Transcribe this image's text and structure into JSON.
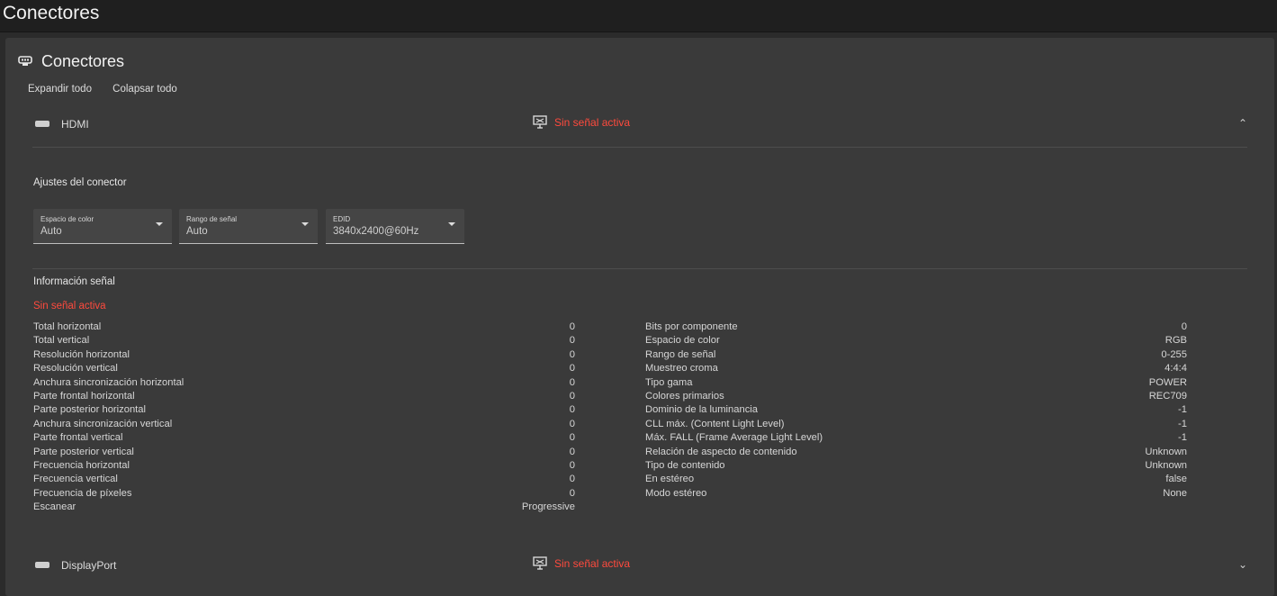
{
  "window": {
    "title": "Conectores"
  },
  "card": {
    "title": "Conectores",
    "expand_all": "Expandir todo",
    "collapse_all": "Colapsar todo"
  },
  "colors": {
    "accent_error": "#ff4a3d",
    "background": "#2b2b2b",
    "card": "#3a3a3a"
  },
  "connectors": [
    {
      "name": "HDMI",
      "status": "Sin señal activa",
      "expanded": true,
      "chevron_icon": "chevron-up-icon"
    },
    {
      "name": "DisplayPort",
      "status": "Sin señal activa",
      "expanded": false,
      "chevron_icon": "chevron-down-icon"
    }
  ],
  "settings": {
    "title": "Ajustes del conector",
    "color_space": {
      "label": "Espacio de color",
      "value": "Auto"
    },
    "signal_range": {
      "label": "Rango de señal",
      "value": "Auto"
    },
    "edid": {
      "label": "EDID",
      "value": "3840x2400@60Hz"
    }
  },
  "signal_info": {
    "title": "Información señal",
    "status": "Sin señal activa",
    "left": [
      {
        "label": "Total horizontal",
        "value": "0"
      },
      {
        "label": "Total vertical",
        "value": "0"
      },
      {
        "label": "Resolución horizontal",
        "value": "0"
      },
      {
        "label": "Resolución vertical",
        "value": "0"
      },
      {
        "label": "Anchura sincronización horizontal",
        "value": "0"
      },
      {
        "label": "Parte frontal horizontal",
        "value": "0"
      },
      {
        "label": "Parte posterior horizontal",
        "value": "0"
      },
      {
        "label": "Anchura sincronización vertical",
        "value": "0"
      },
      {
        "label": "Parte frontal vertical",
        "value": "0"
      },
      {
        "label": "Parte posterior vertical",
        "value": "0"
      },
      {
        "label": "Frecuencia horizontal",
        "value": "0"
      },
      {
        "label": "Frecuencia vertical",
        "value": "0"
      },
      {
        "label": "Frecuencia de píxeles",
        "value": "0"
      },
      {
        "label": "Escanear",
        "value": "Progressive"
      }
    ],
    "right": [
      {
        "label": "Bits por componente",
        "value": "0"
      },
      {
        "label": "Espacio de color",
        "value": "RGB"
      },
      {
        "label": "Rango de señal",
        "value": "0-255"
      },
      {
        "label": "Muestreo croma",
        "value": "4:4:4"
      },
      {
        "label": "Tipo gama",
        "value": "POWER"
      },
      {
        "label": "Colores primarios",
        "value": "REC709"
      },
      {
        "label": "Dominio de la luminancia",
        "value": "-1"
      },
      {
        "label": "CLL máx. (Content Light Level)",
        "value": "-1"
      },
      {
        "label": "Máx. FALL (Frame Average Light Level)",
        "value": "-1"
      },
      {
        "label": "Relación de aspecto de contenido",
        "value": "Unknown"
      },
      {
        "label": "Tipo de contenido",
        "value": "Unknown"
      },
      {
        "label": "En estéreo",
        "value": "false"
      },
      {
        "label": "Modo estéreo",
        "value": "None"
      }
    ]
  }
}
